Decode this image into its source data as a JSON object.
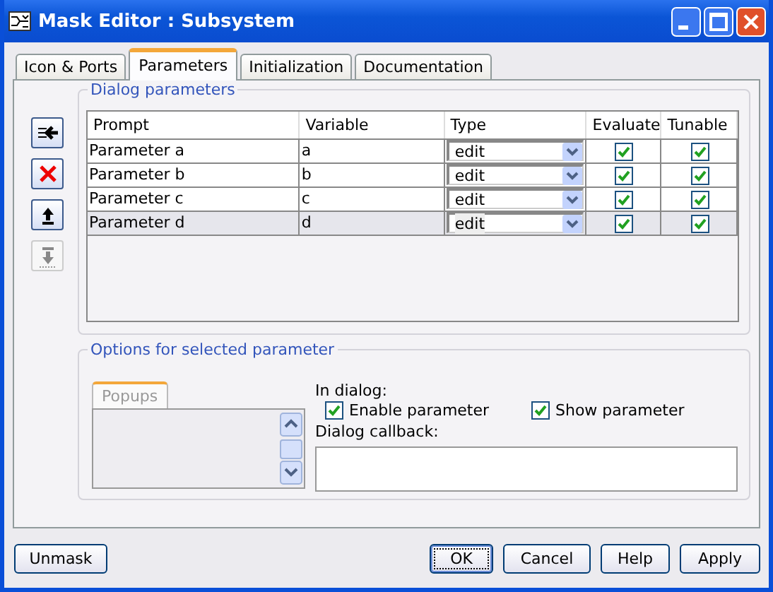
{
  "window": {
    "title": "Mask Editor : Subsystem"
  },
  "tabs": [
    {
      "label": "Icon & Ports",
      "selected": false
    },
    {
      "label": "Parameters",
      "selected": true
    },
    {
      "label": "Initialization",
      "selected": false
    },
    {
      "label": "Documentation",
      "selected": false
    }
  ],
  "toolbar": [
    {
      "kind": "add",
      "disabled": false
    },
    {
      "kind": "delete",
      "disabled": false
    },
    {
      "kind": "up",
      "disabled": false
    },
    {
      "kind": "down",
      "disabled": true
    }
  ],
  "dialog_parameters": {
    "title": "Dialog parameters",
    "columns": [
      "Prompt",
      "Variable",
      "Type",
      "Evaluate",
      "Tunable"
    ],
    "rows": [
      {
        "prompt": "Parameter a",
        "variable": "a",
        "type": "edit",
        "evaluate": true,
        "tunable": true,
        "selected": false
      },
      {
        "prompt": "Parameter b",
        "variable": "b",
        "type": "edit",
        "evaluate": true,
        "tunable": true,
        "selected": false
      },
      {
        "prompt": "Parameter c",
        "variable": "c",
        "type": "edit",
        "evaluate": true,
        "tunable": true,
        "selected": false
      },
      {
        "prompt": "Parameter d",
        "variable": "d",
        "type": "edit",
        "evaluate": true,
        "tunable": true,
        "selected": true
      }
    ]
  },
  "options": {
    "title": "Options for selected parameter",
    "popups_tab": "Popups",
    "in_dialog_label": "In dialog:",
    "enable_parameter": {
      "label": "Enable parameter",
      "checked": true
    },
    "show_parameter": {
      "label": "Show parameter",
      "checked": true
    },
    "callback_label": "Dialog callback:"
  },
  "buttons": [
    {
      "label": "Unmask",
      "default": false
    },
    {
      "label": "OK",
      "default": true
    },
    {
      "label": "Cancel",
      "default": false
    },
    {
      "label": "Help",
      "default": false
    },
    {
      "label": "Apply",
      "default": false
    }
  ]
}
